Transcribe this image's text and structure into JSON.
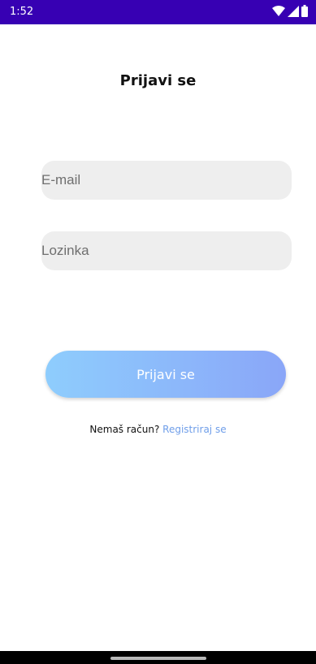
{
  "status_bar": {
    "time": "1:52",
    "icons": [
      "wifi-icon",
      "signal-icon",
      "battery-icon"
    ],
    "background": "#3700b3"
  },
  "login": {
    "title": "Prijavi se",
    "email_placeholder": "E-mail",
    "password_placeholder": "Lozinka",
    "button_label": "Prijavi se",
    "no_account_text": "Nemaš račun?",
    "register_link": "Registriraj se",
    "accent_color": "#6f9ee9",
    "button_gradient": [
      "#8ecdfd",
      "#8aa6f8"
    ]
  }
}
